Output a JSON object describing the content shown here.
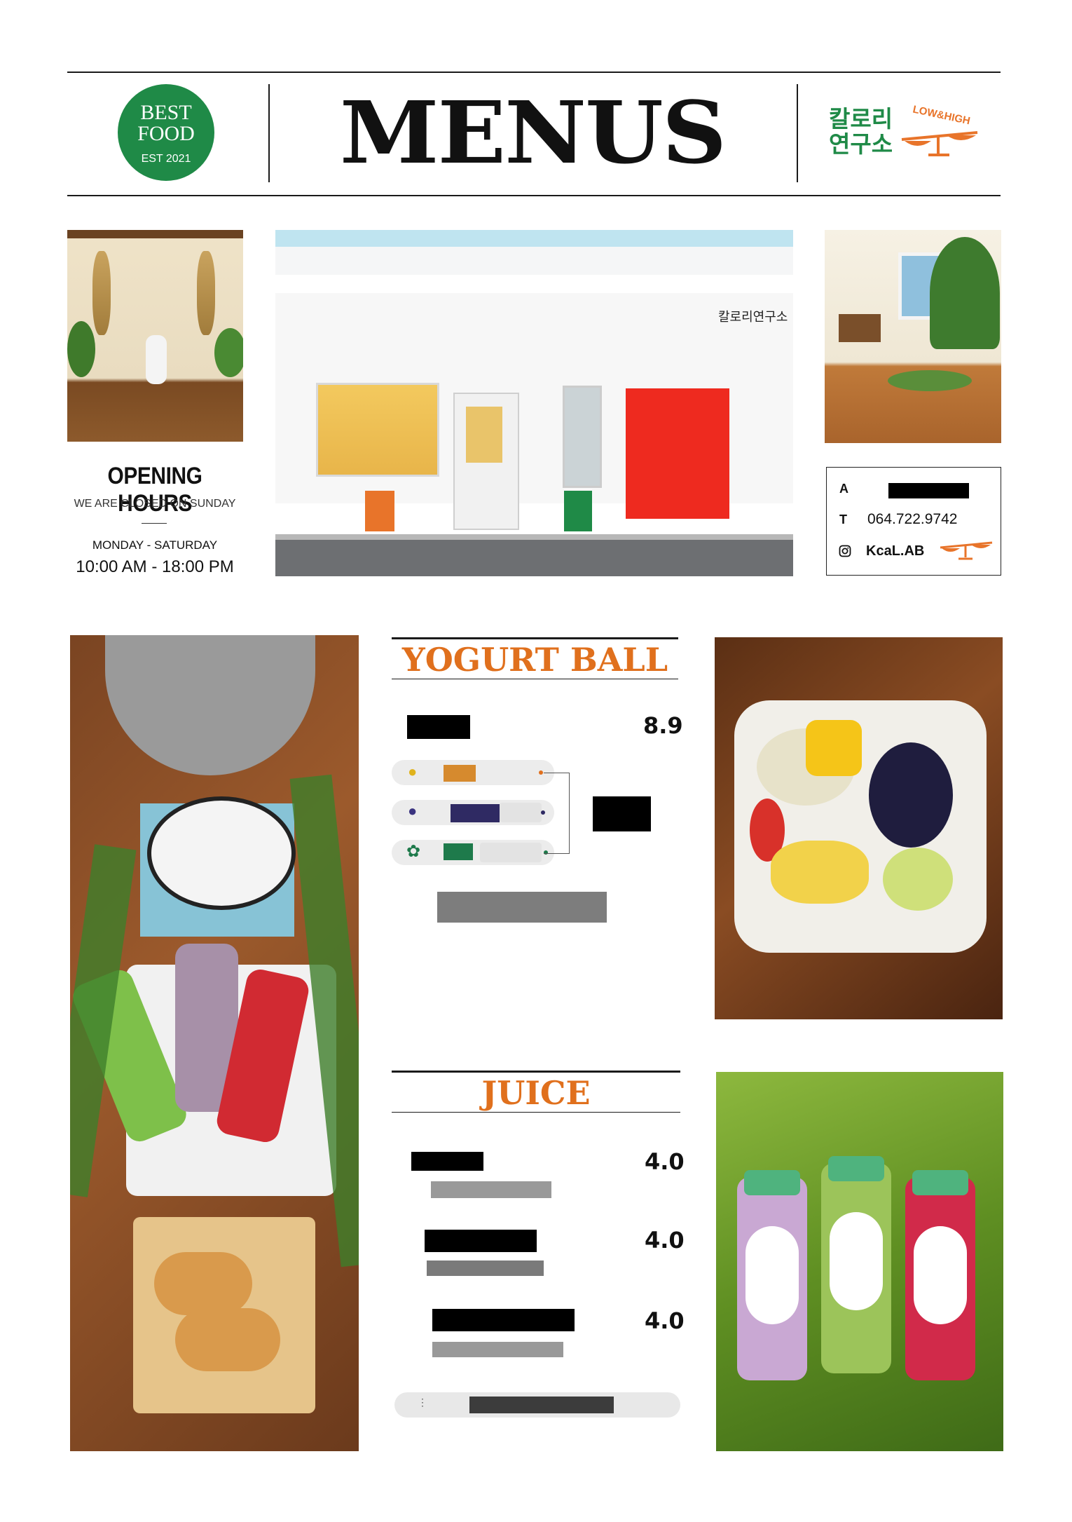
{
  "header": {
    "badge": {
      "line1": "BEST",
      "line2": "FOOD",
      "line3": "EST 2021"
    },
    "title": "MENUS",
    "brand": {
      "name_line1": "칼로리",
      "name_line2": "연구소",
      "tagline": "LOW&HIGH"
    }
  },
  "storefront": {
    "sign_text": "칼로리연구소"
  },
  "opening": {
    "title": "OPENING HOURS",
    "closed_note": "WE ARE CLOSED ON SUNDAY",
    "days": "MONDAY - SATURDAY",
    "hours": "10:00 AM - 18:00 PM"
  },
  "contact": {
    "address_label": "A",
    "phone_label": "T",
    "phone": "064.722.9742",
    "instagram": "KcaL.AB"
  },
  "yogurt_ball": {
    "title": "YOGURT BALL",
    "price": "8.9",
    "options": [
      {
        "icon": "mango-icon",
        "color": "#d68a2e"
      },
      {
        "icon": "blueberry-icon",
        "color": "#2f2a63"
      },
      {
        "icon": "leaf-icon",
        "color": "#1e7a4b"
      }
    ]
  },
  "juice": {
    "title": "JUICE",
    "items": [
      {
        "price": "4.0"
      },
      {
        "price": "4.0"
      },
      {
        "price": "4.0"
      }
    ]
  },
  "colors": {
    "brand_green": "#1f8a47",
    "accent_orange": "#e0701d"
  }
}
